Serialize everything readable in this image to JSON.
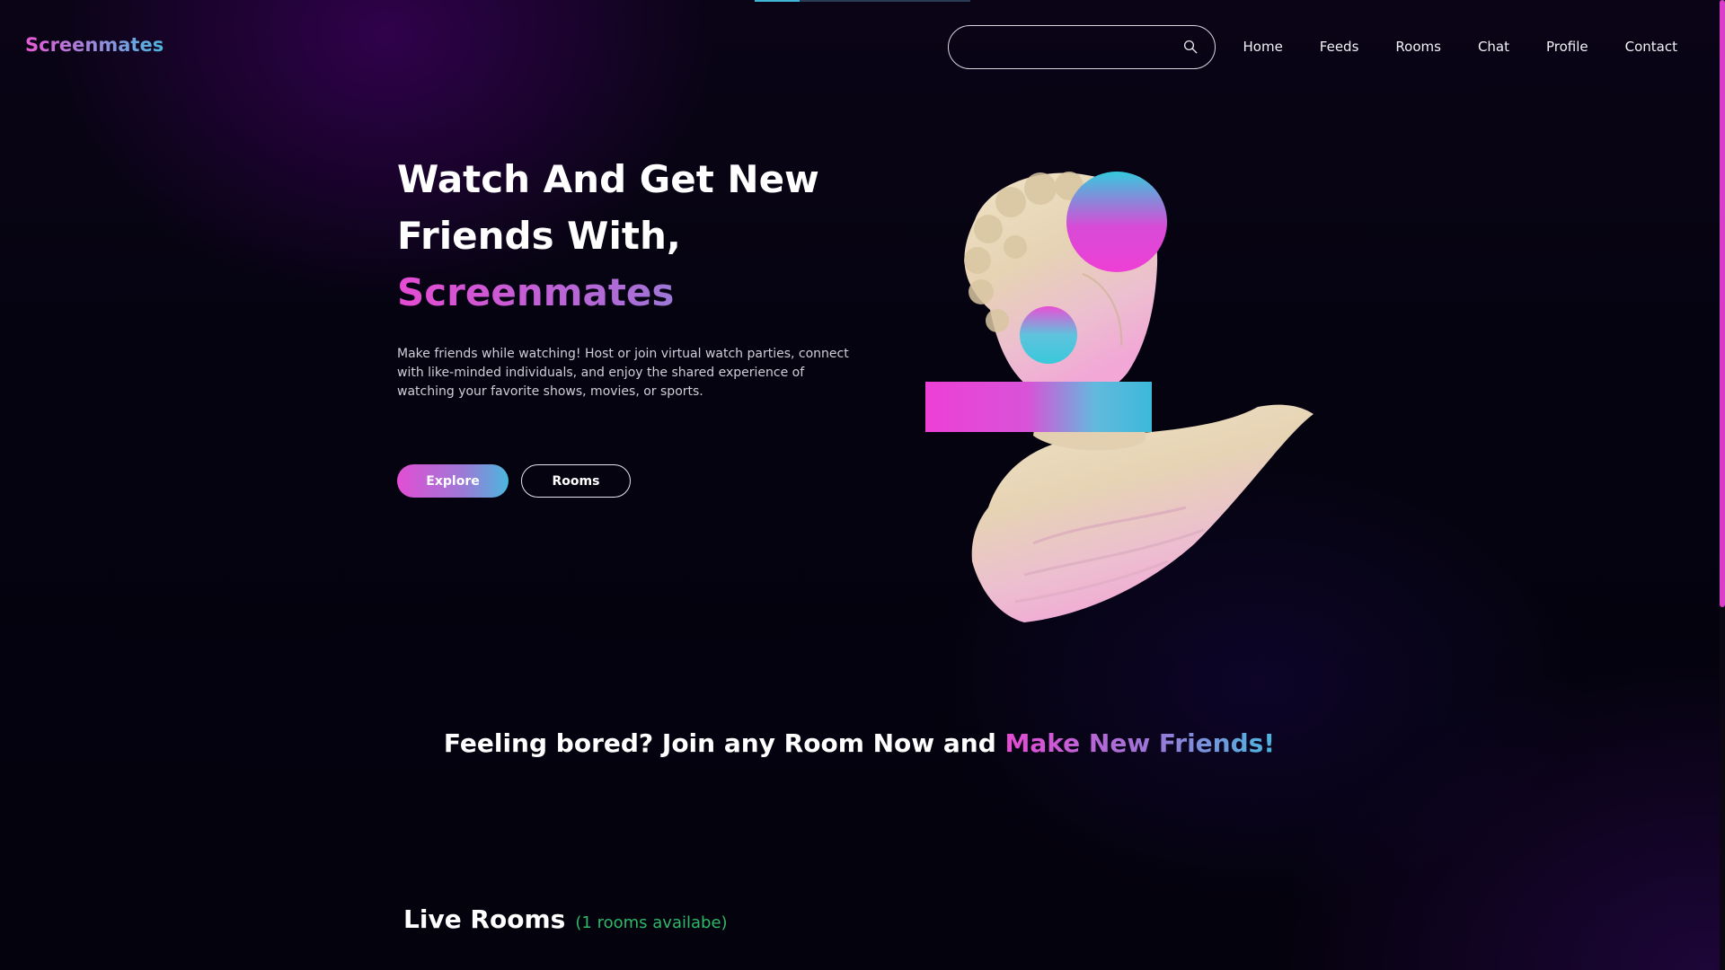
{
  "brand": {
    "name": "Screenmates"
  },
  "search": {
    "value": "",
    "placeholder": ""
  },
  "nav": {
    "items": [
      {
        "label": "Home"
      },
      {
        "label": "Feeds"
      },
      {
        "label": "Rooms"
      },
      {
        "label": "Chat"
      },
      {
        "label": "Profile"
      },
      {
        "label": "Contact"
      }
    ]
  },
  "hero": {
    "title_line1": "Watch And Get New",
    "title_line2": "Friends With,",
    "title_brand": "Screenmates",
    "description": "Make friends while watching! Host or join virtual watch parties, connect with like-minded individuals, and enjoy the shared experience of watching your favorite shows, movies, or sports.",
    "explore_label": "Explore",
    "rooms_label": "Rooms"
  },
  "tagline": {
    "prefix": "Feeling bored? Join any Room Now and ",
    "accent": "Make New Friends!"
  },
  "live_rooms": {
    "title": "Live Rooms",
    "count_text": "(1 rooms availabe)"
  },
  "colors": {
    "gradient_pink": "#e54bd3",
    "gradient_cyan": "#4ab7dd",
    "live_count_green": "#2fb86a",
    "background": "#05030d"
  },
  "icons": {
    "search": "search-icon",
    "hero_art": "statue-bust-illustration"
  }
}
